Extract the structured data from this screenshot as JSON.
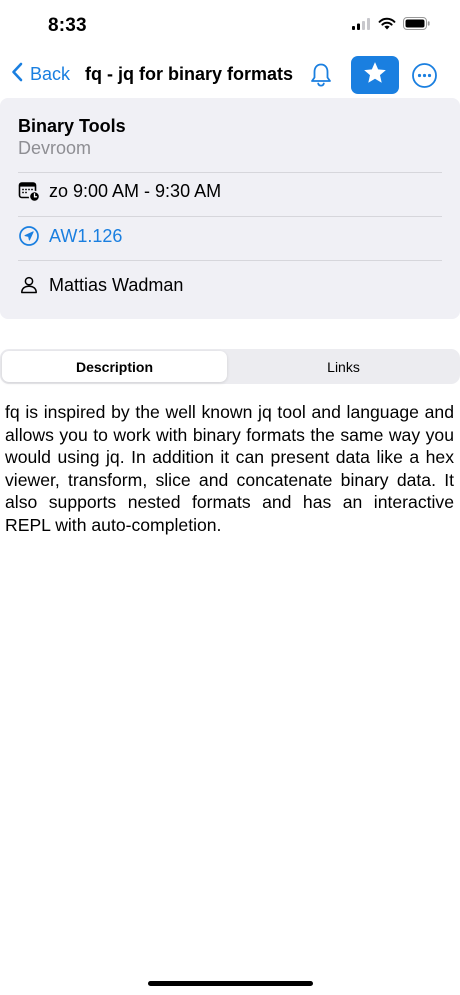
{
  "status_bar": {
    "time": "8:33",
    "icons": [
      "cellular-signal-icon",
      "wifi-icon",
      "battery-icon"
    ]
  },
  "nav": {
    "back_label": "Back",
    "title": "fq - jq for binary formats",
    "icons": [
      "chevron-left-icon",
      "bell-icon",
      "star-icon",
      "more-icon"
    ],
    "accent_color": "#1a7fe0",
    "favorited": true
  },
  "event": {
    "track": "Binary Tools",
    "type": "Devroom",
    "time": "zo 9:00 AM - 9:30 AM",
    "room": "AW1.126",
    "speaker": "Mattias Wadman"
  },
  "tabs": [
    {
      "label": "Description",
      "selected": true
    },
    {
      "label": "Links",
      "selected": false
    }
  ],
  "description": "fq is inspired by the well known jq tool and language and allows you to work with binary formats the same way you would using jq. In addition it can present data like a hex viewer, transform, slice and concatenate binary data. It also supports nested formats and has an interactive REPL with auto-completion."
}
